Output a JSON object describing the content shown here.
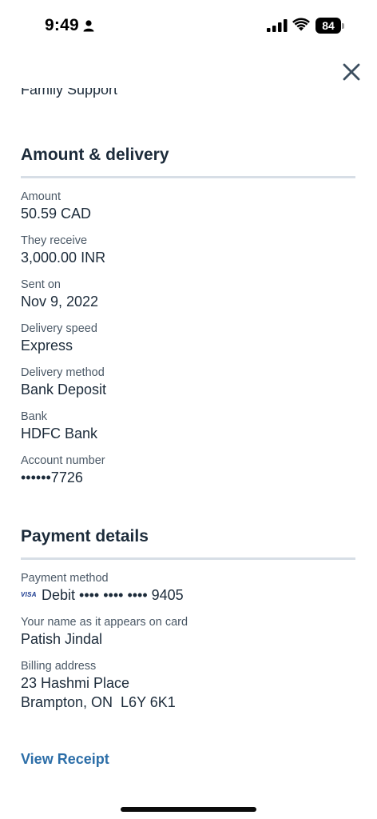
{
  "status_bar": {
    "time": "9:49",
    "battery": "84"
  },
  "header": {
    "close_icon": "close-icon",
    "partial_text": "Family Support"
  },
  "amount_delivery": {
    "title": "Amount & delivery",
    "fields": [
      {
        "label": "Amount",
        "value": "50.59 CAD"
      },
      {
        "label": "They receive",
        "value": "3,000.00 INR"
      },
      {
        "label": "Sent on",
        "value": "Nov 9, 2022"
      },
      {
        "label": "Delivery speed",
        "value": "Express"
      },
      {
        "label": "Delivery method",
        "value": "Bank Deposit"
      },
      {
        "label": "Bank",
        "value": "HDFC Bank"
      },
      {
        "label": "Account number",
        "value": "••••••7726"
      }
    ]
  },
  "payment_details": {
    "title": "Payment details",
    "payment_method_label": "Payment method",
    "card_brand": "VISA",
    "payment_method_value": "Debit •••• •••• •••• 9405",
    "name_label": "Your name as it appears on card",
    "name_value": "Patish Jindal",
    "billing_label": "Billing address",
    "billing_line1": "23 Hashmi Place",
    "billing_line2": "Brampton, ON  L6Y 6K1"
  },
  "actions": {
    "view_receipt": "View Receipt"
  },
  "colors": {
    "text": "#1c2b3a",
    "label": "#4a5866",
    "divider": "#d7dee6",
    "link": "#2c6ea8"
  }
}
